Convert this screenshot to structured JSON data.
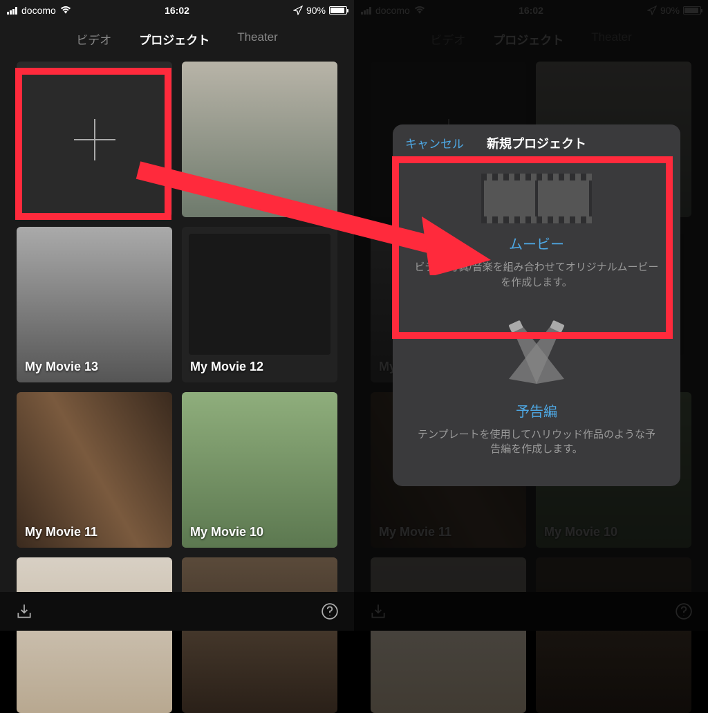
{
  "status": {
    "carrier": "docomo",
    "time": "16:02",
    "battery_pct": "90%"
  },
  "tabs": {
    "video": "ビデオ",
    "projects": "プロジェクト",
    "theater": "Theater"
  },
  "projects": {
    "my_movie_13": "My Movie 13",
    "my_movie_12": "My Movie 12",
    "my_movie_11": "My Movie 11",
    "my_movie_10": "My Movie 10"
  },
  "modal": {
    "cancel": "キャンセル",
    "title": "新規プロジェクト",
    "movie": {
      "title": "ムービー",
      "desc": "ビデオ/写真/音楽を組み合わせてオリジナルムービーを作成します。"
    },
    "trailer": {
      "title": "予告編",
      "desc": "テンプレートを使用してハリウッド作品のような予告編を作成します。"
    }
  }
}
